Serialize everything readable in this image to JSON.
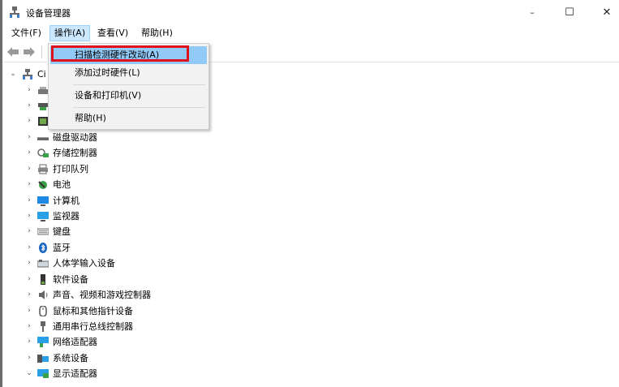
{
  "window": {
    "title": "设备管理器",
    "minimize": "–",
    "maximize": "☐",
    "close": "✕"
  },
  "menubar": {
    "file": "文件(F)",
    "action": "操作(A)",
    "view": "查看(V)",
    "help": "帮助(H)"
  },
  "dropdown": {
    "items": [
      "扫描检测硬件改动(A)",
      "添加过时硬件(L)",
      "设备和打印机(V)",
      "帮助(H)"
    ],
    "highlight_color": "#91c9f7",
    "annotation_color": "#e0101c"
  },
  "tree": {
    "root_label": "Ci",
    "categories": [
      {
        "label": "",
        "icon": "drive-icon"
      },
      {
        "label": "",
        "icon": "keyboard-device-icon"
      },
      {
        "label": "",
        "icon": "processor-icon"
      },
      {
        "label": "磁盘驱动器",
        "icon": "disk-icon"
      },
      {
        "label": "存储控制器",
        "icon": "storage-controller-icon"
      },
      {
        "label": "打印队列",
        "icon": "printer-icon"
      },
      {
        "label": "电池",
        "icon": "battery-icon"
      },
      {
        "label": "计算机",
        "icon": "computer-icon"
      },
      {
        "label": "监视器",
        "icon": "monitor-icon"
      },
      {
        "label": "键盘",
        "icon": "keyboard-icon"
      },
      {
        "label": "蓝牙",
        "icon": "bluetooth-icon"
      },
      {
        "label": "人体学输入设备",
        "icon": "hid-icon"
      },
      {
        "label": "软件设备",
        "icon": "software-device-icon"
      },
      {
        "label": "声音、视频和游戏控制器",
        "icon": "speaker-icon"
      },
      {
        "label": "鼠标和其他指针设备",
        "icon": "mouse-icon"
      },
      {
        "label": "通用串行总线控制器",
        "icon": "usb-icon"
      },
      {
        "label": "网络适配器",
        "icon": "network-icon"
      },
      {
        "label": "系统设备",
        "icon": "system-device-icon"
      },
      {
        "label": "显示适配器",
        "icon": "display-adapter-icon"
      }
    ]
  }
}
